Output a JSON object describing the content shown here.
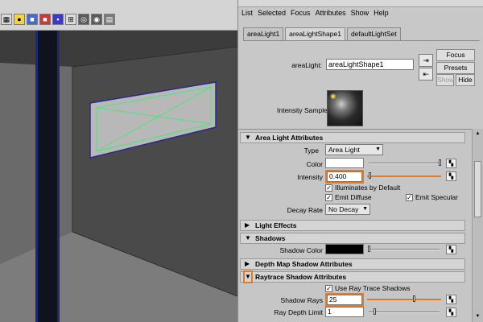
{
  "menu": [
    "List",
    "Selected",
    "Focus",
    "Attributes",
    "Show",
    "Help"
  ],
  "tabs": [
    {
      "label": "areaLight1",
      "active": false
    },
    {
      "label": "areaLightShape1",
      "active": true
    },
    {
      "label": "defaultLightSet",
      "active": false
    }
  ],
  "node": {
    "label": "areaLight:",
    "value": "areaLightShape1"
  },
  "buttons": {
    "focus": "Focus",
    "presets": "Presets",
    "show": "Show",
    "hide": "Hide"
  },
  "sample": {
    "label": "Intensity Sample"
  },
  "sections": {
    "area_light": "Area Light Attributes",
    "light_effects": "Light Effects",
    "shadows": "Shadows",
    "depth_map": "Depth Map Shadow Attributes",
    "raytrace": "Raytrace Shadow Attributes"
  },
  "area_light": {
    "type_label": "Type",
    "type_value": "Area Light",
    "color_label": "Color",
    "intensity_label": "Intensity",
    "intensity_value": "0.400",
    "illuminates_label": "Illuminates by Default",
    "emit_diffuse_label": "Emit Diffuse",
    "emit_specular_label": "Emit Specular",
    "decay_label": "Decay Rate",
    "decay_value": "No Decay"
  },
  "shadows": {
    "shadow_color_label": "Shadow Color"
  },
  "raytrace": {
    "use_label": "Use Ray Trace Shadows",
    "rays_label": "Shadow Rays",
    "rays_value": "25",
    "depth_label": "Ray Depth Limit",
    "depth_value": "1"
  },
  "colors": {
    "highlight": "#e07b2c",
    "viewport_bg": "#5a5a5a",
    "panel_bg": "#c8c8c8"
  }
}
